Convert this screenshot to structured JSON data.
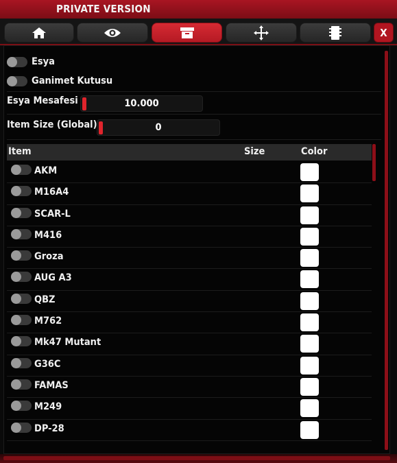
{
  "window": {
    "title": "PRIVATE VERSION",
    "close_label": "X"
  },
  "tabs": [
    {
      "icon": "home-icon",
      "active": false
    },
    {
      "icon": "eye-icon",
      "active": false
    },
    {
      "icon": "archive-box-icon",
      "active": true
    },
    {
      "icon": "crosshair-icon",
      "active": false
    },
    {
      "icon": "chip-icon",
      "active": false
    }
  ],
  "toggles": {
    "esya": {
      "label": "Esya",
      "on": false
    },
    "ganimet": {
      "label": "Ganimet Kutusu",
      "on": false
    }
  },
  "sliders": {
    "esya_mesafesi": {
      "label": "Esya Mesafesi",
      "value": "10.000"
    },
    "item_size": {
      "label": "Item Size (Global)",
      "value": "0"
    }
  },
  "table": {
    "headers": {
      "item": "Item",
      "size": "Size",
      "color": "Color"
    },
    "rows": [
      {
        "name": "AKM",
        "color": "#ffffff"
      },
      {
        "name": "M16A4",
        "color": "#ffffff"
      },
      {
        "name": "SCAR-L",
        "color": "#ffffff"
      },
      {
        "name": "M416",
        "color": "#ffffff"
      },
      {
        "name": "Groza",
        "color": "#ffffff"
      },
      {
        "name": "AUG A3",
        "color": "#ffffff"
      },
      {
        "name": "QBZ",
        "color": "#ffffff"
      },
      {
        "name": "M762",
        "color": "#ffffff"
      },
      {
        "name": "Mk47 Mutant",
        "color": "#ffffff"
      },
      {
        "name": "G36C",
        "color": "#ffffff"
      },
      {
        "name": "FAMAS",
        "color": "#ffffff"
      },
      {
        "name": "M249",
        "color": "#ffffff"
      },
      {
        "name": "DP-28",
        "color": "#ffffff"
      }
    ]
  },
  "colors": {
    "accent": "#b51a24",
    "title_bar": "#9a1320",
    "toggle_off": "#3a3a3a"
  }
}
